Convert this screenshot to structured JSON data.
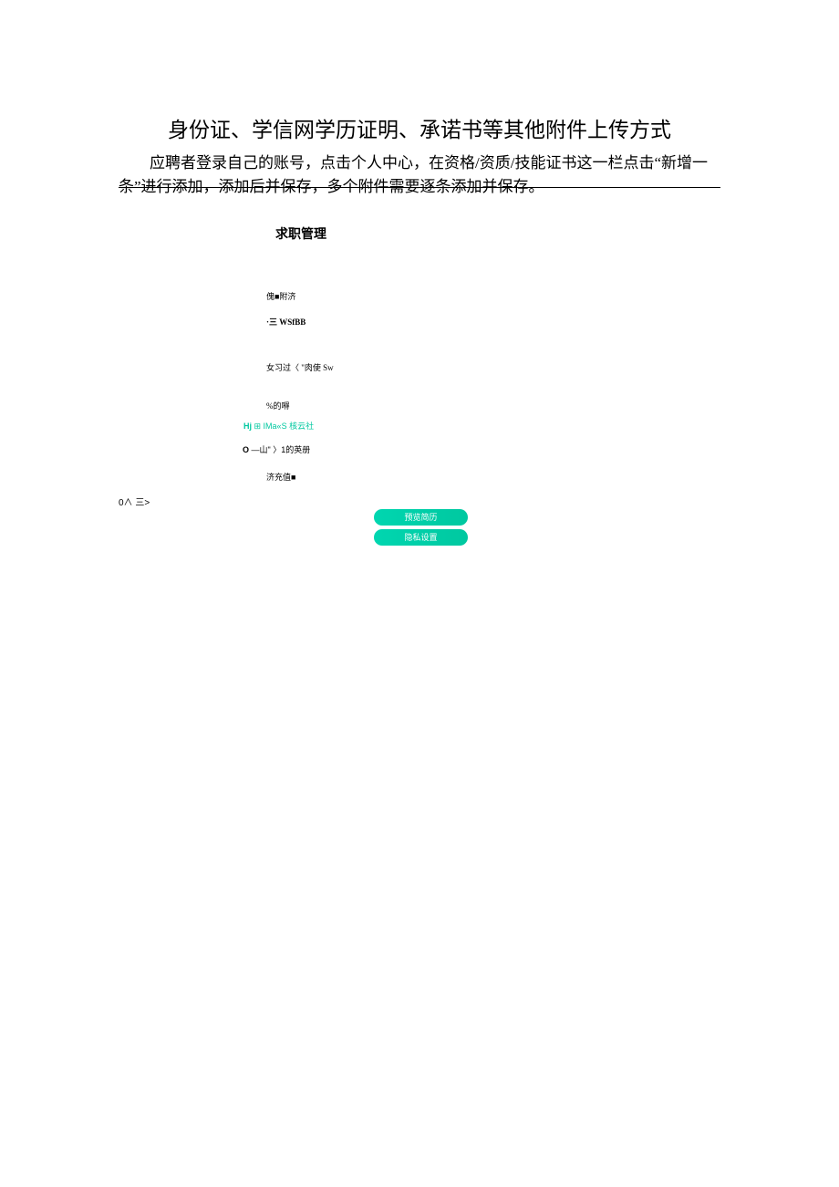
{
  "title": "身份证、学信网学历证明、承诺书等其他附件上传方式",
  "description": "应聘者登录自己的账号，点击个人中心，在资格/资质/技能证书这一栏点击“新增一条”进行添加，添加后并保存，多个附件需要逐条添加并保存。",
  "section_header": "求职管理",
  "sidebar": {
    "item1": "傀■附济",
    "item2": "·三 WSfBB",
    "item3": "女习过〈 \"肉使 Sw",
    "item4": "%的嘚",
    "item5_prefix": "Hj ",
    "item5_main": "⊞ IMa«S",
    "item5_suffix": " 核云社",
    "item6": "O —山\" 〉1的英册",
    "item7": "济充值■"
  },
  "small_label": "0∧ 三>",
  "buttons": {
    "preview": "预览简历",
    "privacy": "隐私设置"
  }
}
